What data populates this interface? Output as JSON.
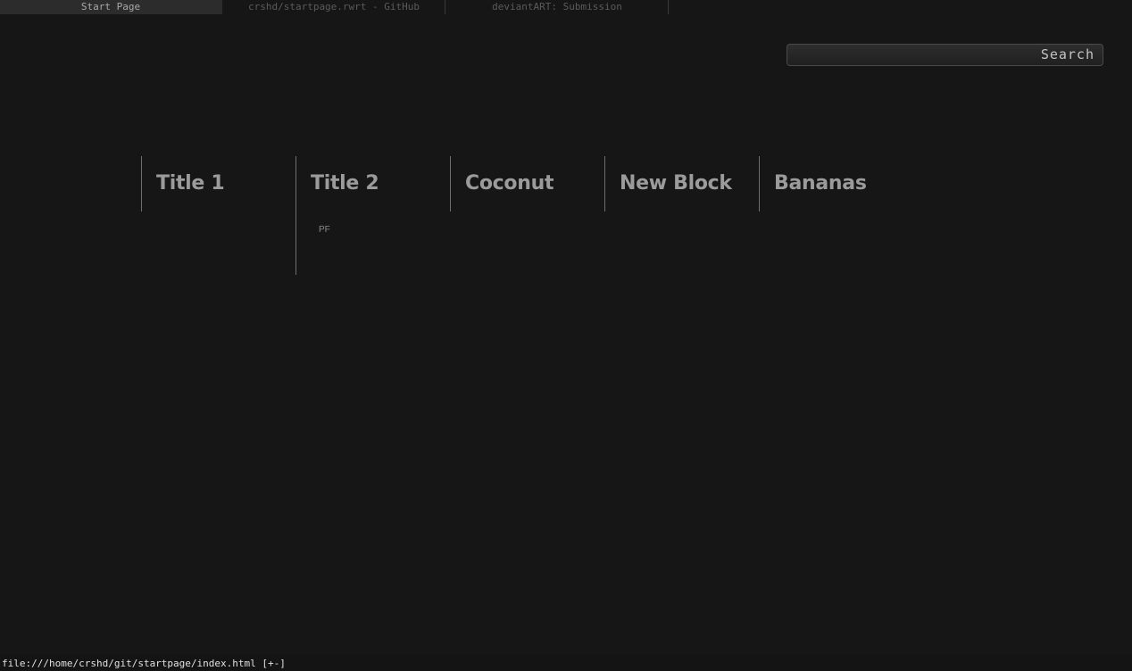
{
  "tabs": [
    {
      "label": "Start Page",
      "active": true
    },
    {
      "label": "crshd/startpage.rwrt - GitHub",
      "active": false
    },
    {
      "label": "deviantART: Submission",
      "active": false
    }
  ],
  "search": {
    "value": "",
    "button_label": "Search"
  },
  "blocks": [
    {
      "title": "Title 1",
      "links": []
    },
    {
      "title": "Title 2",
      "links": [
        "PF"
      ]
    },
    {
      "title": "Coconut",
      "links": []
    },
    {
      "title": "New Block",
      "links": []
    },
    {
      "title": "Bananas",
      "links": []
    }
  ],
  "statusbar": {
    "url": "file:///home/crshd/git/startpage/index.html [+-]"
  },
  "colors": {
    "background": "#161616",
    "active_tab": "#2c2c2c",
    "title_text": "#9b9b9b",
    "divider": "#6e6e6e"
  }
}
